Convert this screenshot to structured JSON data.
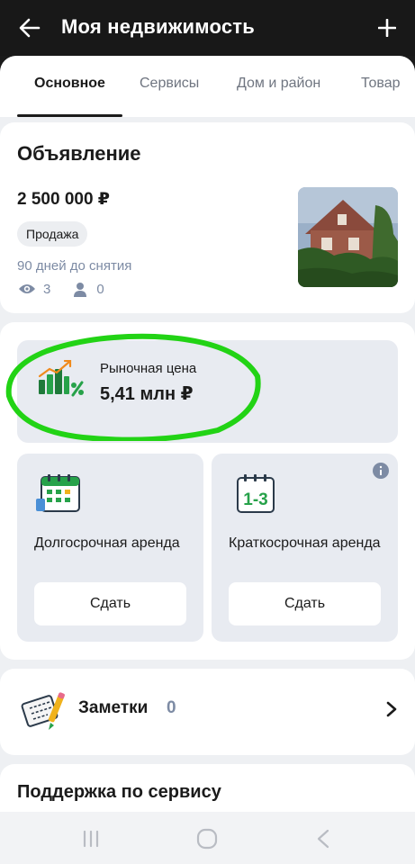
{
  "header": {
    "title": "Моя недвижимость"
  },
  "tabs": [
    {
      "label": "Основное",
      "active": true
    },
    {
      "label": "Сервисы",
      "active": false
    },
    {
      "label": "Дом и район",
      "active": false
    },
    {
      "label": "Товар",
      "active": false
    }
  ],
  "listing": {
    "section_title": "Объявление",
    "price": "2 500 000 ₽",
    "deal_type": "Продажа",
    "expires": "90 дней до снятия",
    "views": "3",
    "contacts": "0"
  },
  "market": {
    "label": "Рыночная цена",
    "value": "5,41 млн ₽"
  },
  "rent": [
    {
      "label": "Долгосрочная аренда",
      "button": "Сдать"
    },
    {
      "label": "Краткосрочная аренда",
      "button": "Сдать",
      "icon_text": "1-3"
    }
  ],
  "notes": {
    "label": "Заметки",
    "count": "0"
  },
  "support": {
    "title": "Поддержка по сервису"
  },
  "colors": {
    "highlight": "#22d315",
    "accent_green": "#27a24a",
    "muted_text": "#7d8ba4"
  }
}
